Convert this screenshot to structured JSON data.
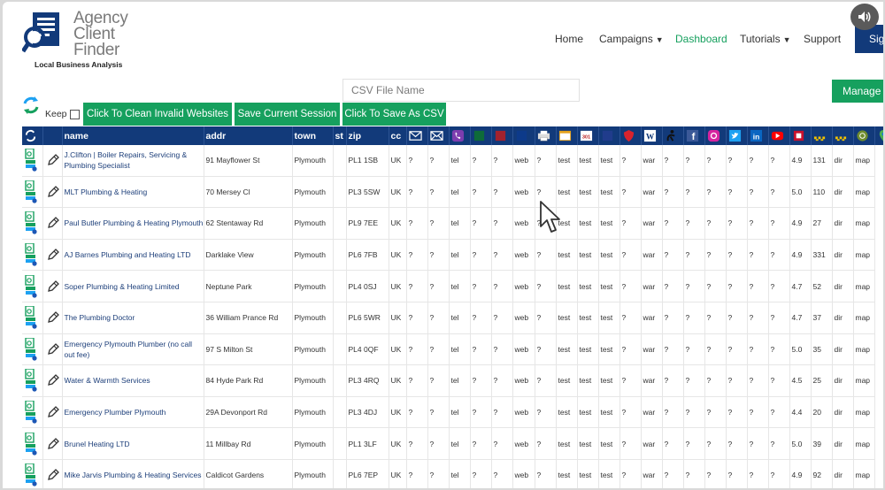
{
  "logo": {
    "line1": "Agency",
    "line2": "Client",
    "line3": "Finder",
    "tagline": "Local Business Analysis"
  },
  "nav": {
    "home": "Home",
    "campaigns": "Campaigns",
    "dashboard": "Dashboard",
    "tutorials": "Tutorials",
    "support": "Support",
    "signup_partial": "Sig",
    "active_color": "#16a05e"
  },
  "toolbar": {
    "csv_placeholder": "CSV File Name",
    "manage_label": "Manage E",
    "keep_label": "Keep",
    "clean_label": "Click To Clean Invalid Websites",
    "save_session_label": "Save Current Session",
    "save_csv_label": "Click To Save As CSV"
  },
  "colors": {
    "header_blue": "#123a7a",
    "button_green": "#16a05e"
  },
  "table": {
    "headers": {
      "name": "name",
      "addr": "addr",
      "town": "town",
      "st": "st",
      "zip": "zip",
      "cc": "cc"
    },
    "icon_columns": [
      "email-icon",
      "email-check-icon",
      "viber-icon",
      "green-icon",
      "red-icon",
      "blue-icon",
      "printer-icon",
      "calendar-icon",
      "301-icon",
      "blue-square-icon",
      "shield-icon",
      "wordpress-icon",
      "accessibility-icon",
      "facebook-icon",
      "instagram-icon",
      "twitter-icon",
      "linkedin-icon",
      "youtube-icon",
      "square-icon",
      "rating-icon",
      "reviews-icon",
      "direction-icon",
      "map-pin-icon"
    ],
    "rows": [
      {
        "name": "J.Clifton | Boiler Repairs, Servicing & Plumbing Specialist",
        "addr": "91 Mayflower St",
        "town": "Plymouth",
        "st": "",
        "zip": "PL1 1SB",
        "cc": "UK",
        "c1": "?",
        "c2": "?",
        "tel": "tel",
        "c4": "?",
        "c5": "?",
        "web": "web",
        "c7": "?",
        "t1": "test",
        "t2": "test",
        "t3": "test",
        "c11": "?",
        "war": "war",
        "c13": "?",
        "c14": "?",
        "c15": "?",
        "c16": "?",
        "c17": "?",
        "c18": "?",
        "rating": "4.9",
        "reviews": "131",
        "dir": "dir",
        "map": "map"
      },
      {
        "name": "MLT Plumbing & Heating",
        "addr": "70 Mersey Cl",
        "town": "Plymouth",
        "st": "",
        "zip": "PL3 5SW",
        "cc": "UK",
        "c1": "?",
        "c2": "?",
        "tel": "tel",
        "c4": "?",
        "c5": "?",
        "web": "web",
        "c7": "?",
        "t1": "test",
        "t2": "test",
        "t3": "test",
        "c11": "?",
        "war": "war",
        "c13": "?",
        "c14": "?",
        "c15": "?",
        "c16": "?",
        "c17": "?",
        "c18": "?",
        "rating": "5.0",
        "reviews": "110",
        "dir": "dir",
        "map": "map"
      },
      {
        "name": "Paul Butler Plumbing & Heating Plymouth",
        "addr": "62 Stentaway Rd",
        "town": "Plymouth",
        "st": "",
        "zip": "PL9 7EE",
        "cc": "UK",
        "c1": "?",
        "c2": "?",
        "tel": "tel",
        "c4": "?",
        "c5": "?",
        "web": "web",
        "c7": "?",
        "t1": "test",
        "t2": "test",
        "t3": "test",
        "c11": "?",
        "war": "war",
        "c13": "?",
        "c14": "?",
        "c15": "?",
        "c16": "?",
        "c17": "?",
        "c18": "?",
        "rating": "4.9",
        "reviews": "27",
        "dir": "dir",
        "map": "map"
      },
      {
        "name": "AJ Barnes Plumbing and Heating LTD",
        "addr": "Darklake View",
        "town": "Plymouth",
        "st": "",
        "zip": "PL6 7FB",
        "cc": "UK",
        "c1": "?",
        "c2": "?",
        "tel": "tel",
        "c4": "?",
        "c5": "?",
        "web": "web",
        "c7": "?",
        "t1": "test",
        "t2": "test",
        "t3": "test",
        "c11": "?",
        "war": "war",
        "c13": "?",
        "c14": "?",
        "c15": "?",
        "c16": "?",
        "c17": "?",
        "c18": "?",
        "rating": "4.9",
        "reviews": "331",
        "dir": "dir",
        "map": "map"
      },
      {
        "name": "Soper Plumbing & Heating Limited",
        "addr": "Neptune Park",
        "town": "Plymouth",
        "st": "",
        "zip": "PL4 0SJ",
        "cc": "UK",
        "c1": "?",
        "c2": "?",
        "tel": "tel",
        "c4": "?",
        "c5": "?",
        "web": "web",
        "c7": "?",
        "t1": "test",
        "t2": "test",
        "t3": "test",
        "c11": "?",
        "war": "war",
        "c13": "?",
        "c14": "?",
        "c15": "?",
        "c16": "?",
        "c17": "?",
        "c18": "?",
        "rating": "4.7",
        "reviews": "52",
        "dir": "dir",
        "map": "map"
      },
      {
        "name": "The Plumbing Doctor",
        "addr": "36 William Prance Rd",
        "town": "Plymouth",
        "st": "",
        "zip": "PL6 5WR",
        "cc": "UK",
        "c1": "?",
        "c2": "?",
        "tel": "tel",
        "c4": "?",
        "c5": "?",
        "web": "web",
        "c7": "?",
        "t1": "test",
        "t2": "test",
        "t3": "test",
        "c11": "?",
        "war": "war",
        "c13": "?",
        "c14": "?",
        "c15": "?",
        "c16": "?",
        "c17": "?",
        "c18": "?",
        "rating": "4.7",
        "reviews": "37",
        "dir": "dir",
        "map": "map"
      },
      {
        "name": "Emergency Plymouth Plumber (no call out fee)",
        "addr": "97 S Milton St",
        "town": "Plymouth",
        "st": "",
        "zip": "PL4 0QF",
        "cc": "UK",
        "c1": "?",
        "c2": "?",
        "tel": "tel",
        "c4": "?",
        "c5": "?",
        "web": "web",
        "c7": "?",
        "t1": "test",
        "t2": "test",
        "t3": "test",
        "c11": "?",
        "war": "war",
        "c13": "?",
        "c14": "?",
        "c15": "?",
        "c16": "?",
        "c17": "?",
        "c18": "?",
        "rating": "5.0",
        "reviews": "35",
        "dir": "dir",
        "map": "map"
      },
      {
        "name": "Water & Warmth Services",
        "addr": "84 Hyde Park Rd",
        "town": "Plymouth",
        "st": "",
        "zip": "PL3 4RQ",
        "cc": "UK",
        "c1": "?",
        "c2": "?",
        "tel": "tel",
        "c4": "?",
        "c5": "?",
        "web": "web",
        "c7": "?",
        "t1": "test",
        "t2": "test",
        "t3": "test",
        "c11": "?",
        "war": "war",
        "c13": "?",
        "c14": "?",
        "c15": "?",
        "c16": "?",
        "c17": "?",
        "c18": "?",
        "rating": "4.5",
        "reviews": "25",
        "dir": "dir",
        "map": "map"
      },
      {
        "name": "Emergency Plumber Plymouth",
        "addr": "29A Devonport Rd",
        "town": "Plymouth",
        "st": "",
        "zip": "PL3 4DJ",
        "cc": "UK",
        "c1": "?",
        "c2": "?",
        "tel": "tel",
        "c4": "?",
        "c5": "?",
        "web": "web",
        "c7": "?",
        "t1": "test",
        "t2": "test",
        "t3": "test",
        "c11": "?",
        "war": "war",
        "c13": "?",
        "c14": "?",
        "c15": "?",
        "c16": "?",
        "c17": "?",
        "c18": "?",
        "rating": "4.4",
        "reviews": "20",
        "dir": "dir",
        "map": "map"
      },
      {
        "name": "Brunel Heating LTD",
        "addr": "11 Millbay Rd",
        "town": "Plymouth",
        "st": "",
        "zip": "PL1 3LF",
        "cc": "UK",
        "c1": "?",
        "c2": "?",
        "tel": "tel",
        "c4": "?",
        "c5": "?",
        "web": "web",
        "c7": "?",
        "t1": "test",
        "t2": "test",
        "t3": "test",
        "c11": "?",
        "war": "war",
        "c13": "?",
        "c14": "?",
        "c15": "?",
        "c16": "?",
        "c17": "?",
        "c18": "?",
        "rating": "5.0",
        "reviews": "39",
        "dir": "dir",
        "map": "map"
      },
      {
        "name": "Mike Jarvis Plumbing & Heating Services",
        "addr": "Caldicot Gardens",
        "town": "Plymouth",
        "st": "",
        "zip": "PL6 7EP",
        "cc": "UK",
        "c1": "?",
        "c2": "?",
        "tel": "tel",
        "c4": "?",
        "c5": "?",
        "web": "web",
        "c7": "?",
        "t1": "test",
        "t2": "test",
        "t3": "test",
        "c11": "?",
        "war": "war",
        "c13": "?",
        "c14": "?",
        "c15": "?",
        "c16": "?",
        "c17": "?",
        "c18": "?",
        "rating": "4.9",
        "reviews": "92",
        "dir": "dir",
        "map": "map"
      }
    ]
  }
}
